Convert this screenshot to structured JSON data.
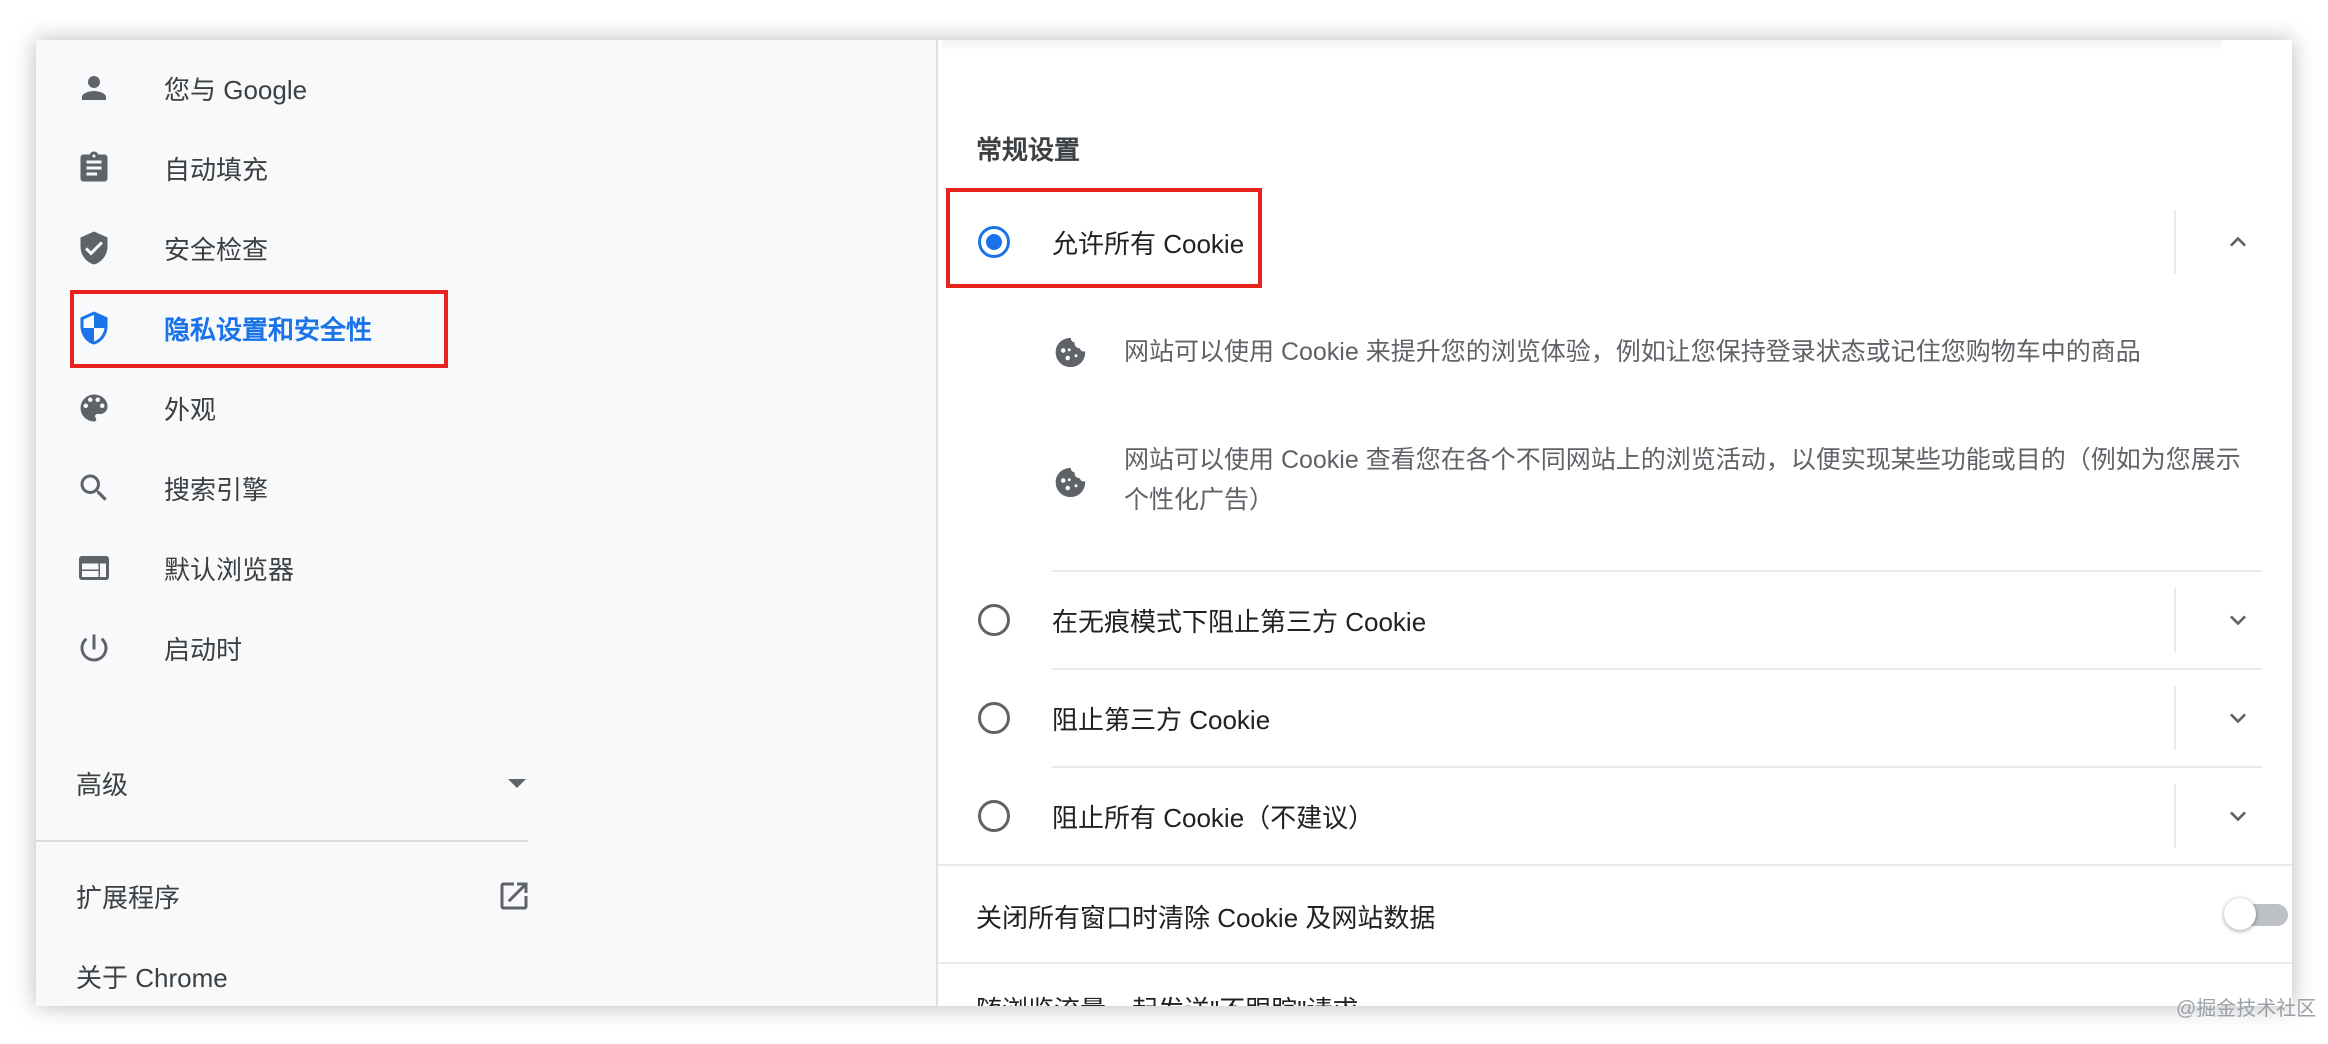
{
  "sidebar": {
    "items": [
      {
        "label": "您与 Google",
        "icon": "person-icon"
      },
      {
        "label": "自动填充",
        "icon": "clipboard-icon"
      },
      {
        "label": "安全检查",
        "icon": "shield-check-icon"
      },
      {
        "label": "隐私设置和安全性",
        "icon": "shield-privacy-icon",
        "active": true
      },
      {
        "label": "外观",
        "icon": "palette-icon"
      },
      {
        "label": "搜索引擎",
        "icon": "search-icon"
      },
      {
        "label": "默认浏览器",
        "icon": "browser-window-icon"
      },
      {
        "label": "启动时",
        "icon": "power-icon"
      }
    ],
    "advanced_label": "高级",
    "extensions_label": "扩展程序",
    "about_label": "关于 Chrome"
  },
  "main": {
    "section_title": "常规设置",
    "options": [
      {
        "label": "允许所有 Cookie",
        "checked": true,
        "expanded": true
      },
      {
        "label": "在无痕模式下阻止第三方 Cookie",
        "checked": false,
        "expanded": false
      },
      {
        "label": "阻止第三方 Cookie",
        "checked": false,
        "expanded": false
      },
      {
        "label": "阻止所有 Cookie（不建议）",
        "checked": false,
        "expanded": false
      }
    ],
    "descriptions": [
      "网站可以使用 Cookie 来提升您的浏览体验，例如让您保持登录状态或记住您购物车中的商品",
      "网站可以使用 Cookie 查看您在各个不同网站上的浏览活动，以便实现某些功能或目的（例如为您展示个性化广告）"
    ],
    "clear_on_exit_label": "关闭所有窗口时清除 Cookie 及网站数据",
    "clear_on_exit_enabled": false,
    "next_row_partial": "随浏览流量一起发送\"不跟踪\"请求"
  },
  "watermark": "@掘金技术社区",
  "colors": {
    "accent": "#1a73e8",
    "highlight": "#e8231f",
    "icon": "#5f6368"
  }
}
